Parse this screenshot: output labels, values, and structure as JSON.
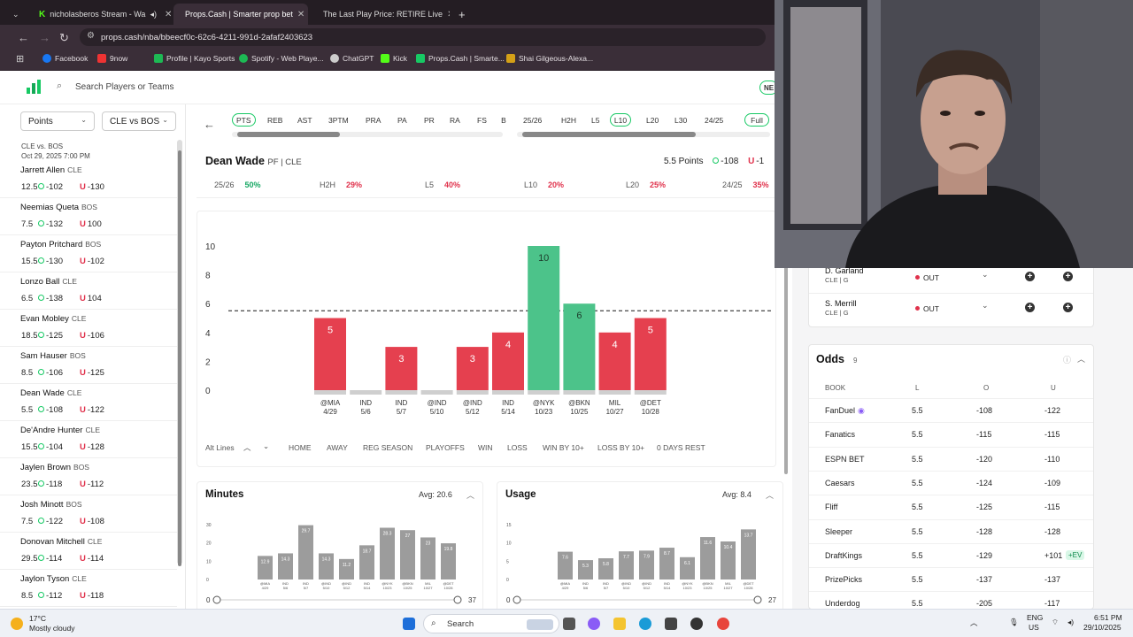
{
  "browser": {
    "tabs": [
      {
        "label": "nicholasberos Stream - Wa"
      },
      {
        "label": "Props.Cash | Smarter prop bet"
      },
      {
        "label": "The Last Play Price: RETIRE Live"
      }
    ],
    "url": "props.cash/nba/bbeecf0c-62c6-4211-991d-2afaf2403623",
    "bookmarks": [
      {
        "label": "Facebook",
        "color": "#1877f2"
      },
      {
        "label": "9now",
        "color": "#e33"
      },
      {
        "label": "Profile | Kayo Sports",
        "color": "#1db954"
      },
      {
        "label": "Spotify - Web Playe...",
        "color": "#1db954"
      },
      {
        "label": "ChatGPT",
        "color": "#ddd"
      },
      {
        "label": "Kick",
        "color": "#53fc18"
      },
      {
        "label": "Props.Cash | Smarte...",
        "color": "#17c964"
      },
      {
        "label": "Shai Gilgeous-Alexa...",
        "color": "#d4a017"
      }
    ]
  },
  "header": {
    "search_placeholder": "Search Players or Teams",
    "new_badge": "NE"
  },
  "left": {
    "stat_select": "Points",
    "game_select": "CLE vs BOS",
    "game_title": "CLE vs. BOS",
    "game_time": "Oct 29, 2025 7:00 PM",
    "players": [
      {
        "name": "Jarrett Allen",
        "team": "CLE",
        "line": "12.5",
        "over": "-102",
        "under": "-130"
      },
      {
        "name": "Neemias Queta",
        "team": "BOS",
        "line": "7.5",
        "over": "-132",
        "under": "100"
      },
      {
        "name": "Payton Pritchard",
        "team": "BOS",
        "line": "15.5",
        "over": "-130",
        "under": "-102"
      },
      {
        "name": "Lonzo Ball",
        "team": "CLE",
        "line": "6.5",
        "over": "-138",
        "under": "104"
      },
      {
        "name": "Evan Mobley",
        "team": "CLE",
        "line": "18.5",
        "over": "-125",
        "under": "-106"
      },
      {
        "name": "Sam Hauser",
        "team": "BOS",
        "line": "8.5",
        "over": "-106",
        "under": "-125"
      },
      {
        "name": "Dean Wade",
        "team": "CLE",
        "line": "5.5",
        "over": "-108",
        "under": "-122"
      },
      {
        "name": "De'Andre Hunter",
        "team": "CLE",
        "line": "15.5",
        "over": "-104",
        "under": "-128"
      },
      {
        "name": "Jaylen Brown",
        "team": "BOS",
        "line": "23.5",
        "over": "-118",
        "under": "-112"
      },
      {
        "name": "Josh Minott",
        "team": "BOS",
        "line": "7.5",
        "over": "-122",
        "under": "-108"
      },
      {
        "name": "Donovan Mitchell",
        "team": "CLE",
        "line": "29.5",
        "over": "-114",
        "under": "-114"
      },
      {
        "name": "Jaylon Tyson",
        "team": "CLE",
        "line": "8.5",
        "over": "-112",
        "under": "-118"
      }
    ]
  },
  "stat_tabs": [
    "PTS",
    "REB",
    "AST",
    "3PTM",
    "PRA",
    "PA",
    "PR",
    "RA",
    "FS",
    "B"
  ],
  "range_tabs": [
    "25/26",
    "H2H",
    "L5",
    "L10",
    "L20",
    "L30",
    "24/25",
    "Full"
  ],
  "player": {
    "name": "Dean Wade",
    "pos_team": "PF | CLE",
    "prop": "5.5 Points",
    "over": "-108",
    "under": "-1"
  },
  "hit_rates": [
    {
      "label": "25/26",
      "value": "50%",
      "good": true
    },
    {
      "label": "H2H",
      "value": "29%",
      "good": false
    },
    {
      "label": "L5",
      "value": "40%",
      "good": false
    },
    {
      "label": "L10",
      "value": "20%",
      "good": false
    },
    {
      "label": "L20",
      "value": "25%",
      "good": false
    },
    {
      "label": "24/25",
      "value": "35%",
      "good": false
    }
  ],
  "chart_data": [
    {
      "type": "bar",
      "title": "",
      "categories": [
        "@MIA 4/29",
        "IND 5/6",
        "IND 5/7",
        "@IND 5/10",
        "@IND 5/12",
        "IND 5/14",
        "@NYK 10/23",
        "@BKN 10/25",
        "MIL 10/27",
        "@DET 10/28"
      ],
      "cat_lines": [
        [
          "@MIA",
          "4/29"
        ],
        [
          "IND",
          "5/6"
        ],
        [
          "IND",
          "5/7"
        ],
        [
          "@IND",
          "5/10"
        ],
        [
          "@IND",
          "5/12"
        ],
        [
          "IND",
          "5/14"
        ],
        [
          "@NYK",
          "10/23"
        ],
        [
          "@BKN",
          "10/25"
        ],
        [
          "MIL",
          "10/27"
        ],
        [
          "@DET",
          "10/28"
        ]
      ],
      "values": [
        5,
        0,
        3,
        0,
        3,
        4,
        10,
        6,
        4,
        5
      ],
      "line": 5.5,
      "ylim": [
        0,
        10
      ],
      "yticks": [
        0,
        2,
        4,
        6,
        8,
        10
      ],
      "colors": {
        "over": "#4cc38a",
        "under": "#e5404f"
      }
    },
    {
      "type": "bar",
      "title": "Minutes",
      "avg_label": "Avg: 20.6",
      "values": [
        12.9,
        14.3,
        29.7,
        14.3,
        11.2,
        18.7,
        28.3,
        27,
        23,
        19.8
      ],
      "ylim": [
        0,
        30
      ],
      "yticks": [
        0,
        10,
        20,
        30
      ],
      "range": [
        "0",
        "37"
      ]
    },
    {
      "type": "bar",
      "title": "Usage",
      "avg_label": "Avg: 8.4",
      "values": [
        7.6,
        5.3,
        5.8,
        7.7,
        7.9,
        8.7,
        6.1,
        11.6,
        10.4,
        13.7
      ],
      "ylim": [
        0,
        15
      ],
      "yticks": [
        0,
        5,
        10,
        15
      ],
      "range": [
        "0",
        "27"
      ]
    }
  ],
  "filters": [
    "Alt Lines",
    "HOME",
    "AWAY",
    "REG SEASON",
    "PLAYOFFS",
    "WIN",
    "LOSS",
    "WIN BY 10+",
    "LOSS BY 10+",
    "0 DAYS REST"
  ],
  "injuries": [
    {
      "name": "D. Garland",
      "sub": "CLE | G",
      "status": "OUT"
    },
    {
      "name": "S. Merrill",
      "sub": "CLE | G",
      "status": "OUT"
    }
  ],
  "odds": {
    "title": "Odds",
    "count": "9",
    "headers": [
      "BOOK",
      "L",
      "O",
      "U"
    ],
    "rows": [
      {
        "book": "FanDuel",
        "line": "5.5",
        "over": "-108",
        "under": "-122",
        "ev": ""
      },
      {
        "book": "Fanatics",
        "line": "5.5",
        "over": "-115",
        "under": "-115",
        "ev": ""
      },
      {
        "book": "ESPN BET",
        "line": "5.5",
        "over": "-120",
        "under": "-110",
        "ev": ""
      },
      {
        "book": "Caesars",
        "line": "5.5",
        "over": "-124",
        "under": "-109",
        "ev": ""
      },
      {
        "book": "Fliff",
        "line": "5.5",
        "over": "-125",
        "under": "-115",
        "ev": ""
      },
      {
        "book": "Sleeper",
        "line": "5.5",
        "over": "-128",
        "under": "-128",
        "ev": ""
      },
      {
        "book": "DraftKings",
        "line": "5.5",
        "over": "-129",
        "under": "+101",
        "ev": "+EV"
      },
      {
        "book": "PrizePicks",
        "line": "5.5",
        "over": "-137",
        "under": "-137",
        "ev": ""
      },
      {
        "book": "Underdog",
        "line": "5.5",
        "over": "-205",
        "under": "-117",
        "ev": ""
      }
    ]
  },
  "taskbar": {
    "weather_temp": "17°C",
    "weather_desc": "Mostly cloudy",
    "search": "Search",
    "lang": "ENG",
    "region": "US",
    "time": "6:51 PM",
    "date": "29/10/2025"
  }
}
